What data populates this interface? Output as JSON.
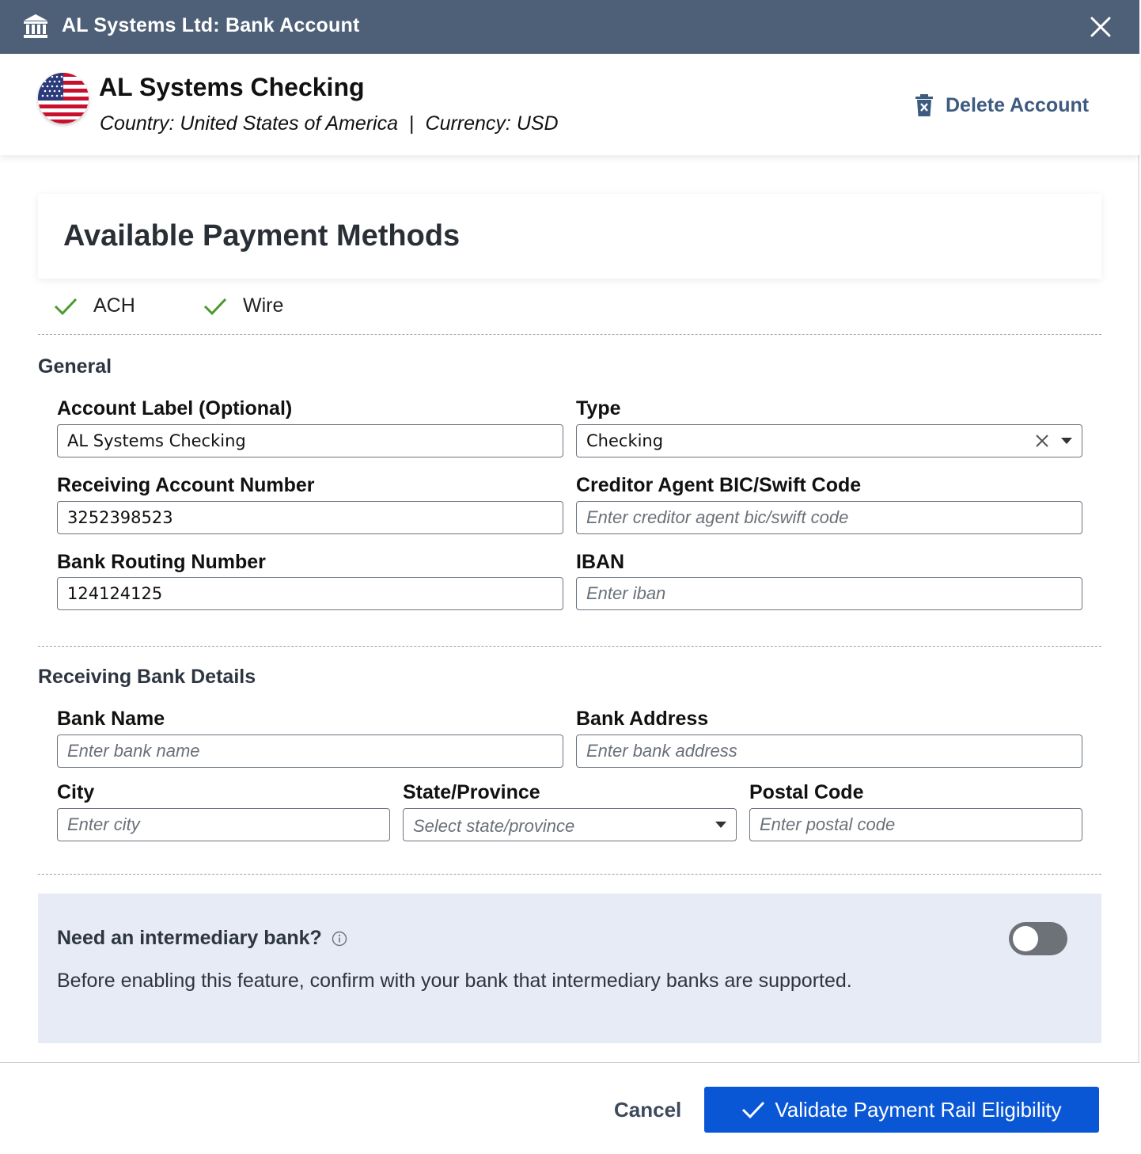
{
  "window": {
    "title": "AL Systems Ltd: Bank Account"
  },
  "account": {
    "name": "AL Systems Checking",
    "country": "Country: United States of America",
    "separator": "|",
    "currency": "Currency: USD",
    "delete_label": "Delete Account"
  },
  "payment_methods": {
    "heading": "Available Payment Methods",
    "items": [
      "ACH",
      "Wire"
    ]
  },
  "general": {
    "title": "General",
    "account_label": {
      "label": "Account Label (Optional)",
      "value": "AL Systems Checking"
    },
    "type": {
      "label": "Type",
      "value": "Checking"
    },
    "receiving_account": {
      "label": "Receiving Account Number",
      "value": "3252398523"
    },
    "bic": {
      "label": "Creditor Agent BIC/Swift Code",
      "placeholder": "Enter creditor agent bic/swift code"
    },
    "routing": {
      "label": "Bank Routing Number",
      "value": "124124125"
    },
    "iban": {
      "label": "IBAN",
      "placeholder": "Enter iban"
    }
  },
  "bank_details": {
    "title": "Receiving Bank Details",
    "bank_name": {
      "label": "Bank Name",
      "placeholder": "Enter bank name"
    },
    "bank_address": {
      "label": "Bank Address",
      "placeholder": "Enter bank address"
    },
    "city": {
      "label": "City",
      "placeholder": "Enter city"
    },
    "state": {
      "label": "State/Province",
      "placeholder": "Select state/province"
    },
    "postal": {
      "label": "Postal Code",
      "placeholder": "Enter postal code"
    }
  },
  "intermediary": {
    "question": "Need an intermediary bank?",
    "description": "Before enabling this feature, confirm with your bank that intermediary banks are supported.",
    "enabled": false
  },
  "footer": {
    "cancel_label": "Cancel",
    "validate_label": "Validate Payment Rail Eligibility"
  },
  "colors": {
    "titlebar": "#4e5f78",
    "primary": "#0a57d6",
    "check_green": "#4a9a2e",
    "link": "#3d5a80",
    "panel_bg": "#e6ebf5"
  },
  "icons": {
    "title": "bank-icon",
    "close": "close-icon",
    "delete": "trash-icon",
    "flag": "us-flag-icon",
    "check": "check-icon",
    "info": "info-icon"
  }
}
